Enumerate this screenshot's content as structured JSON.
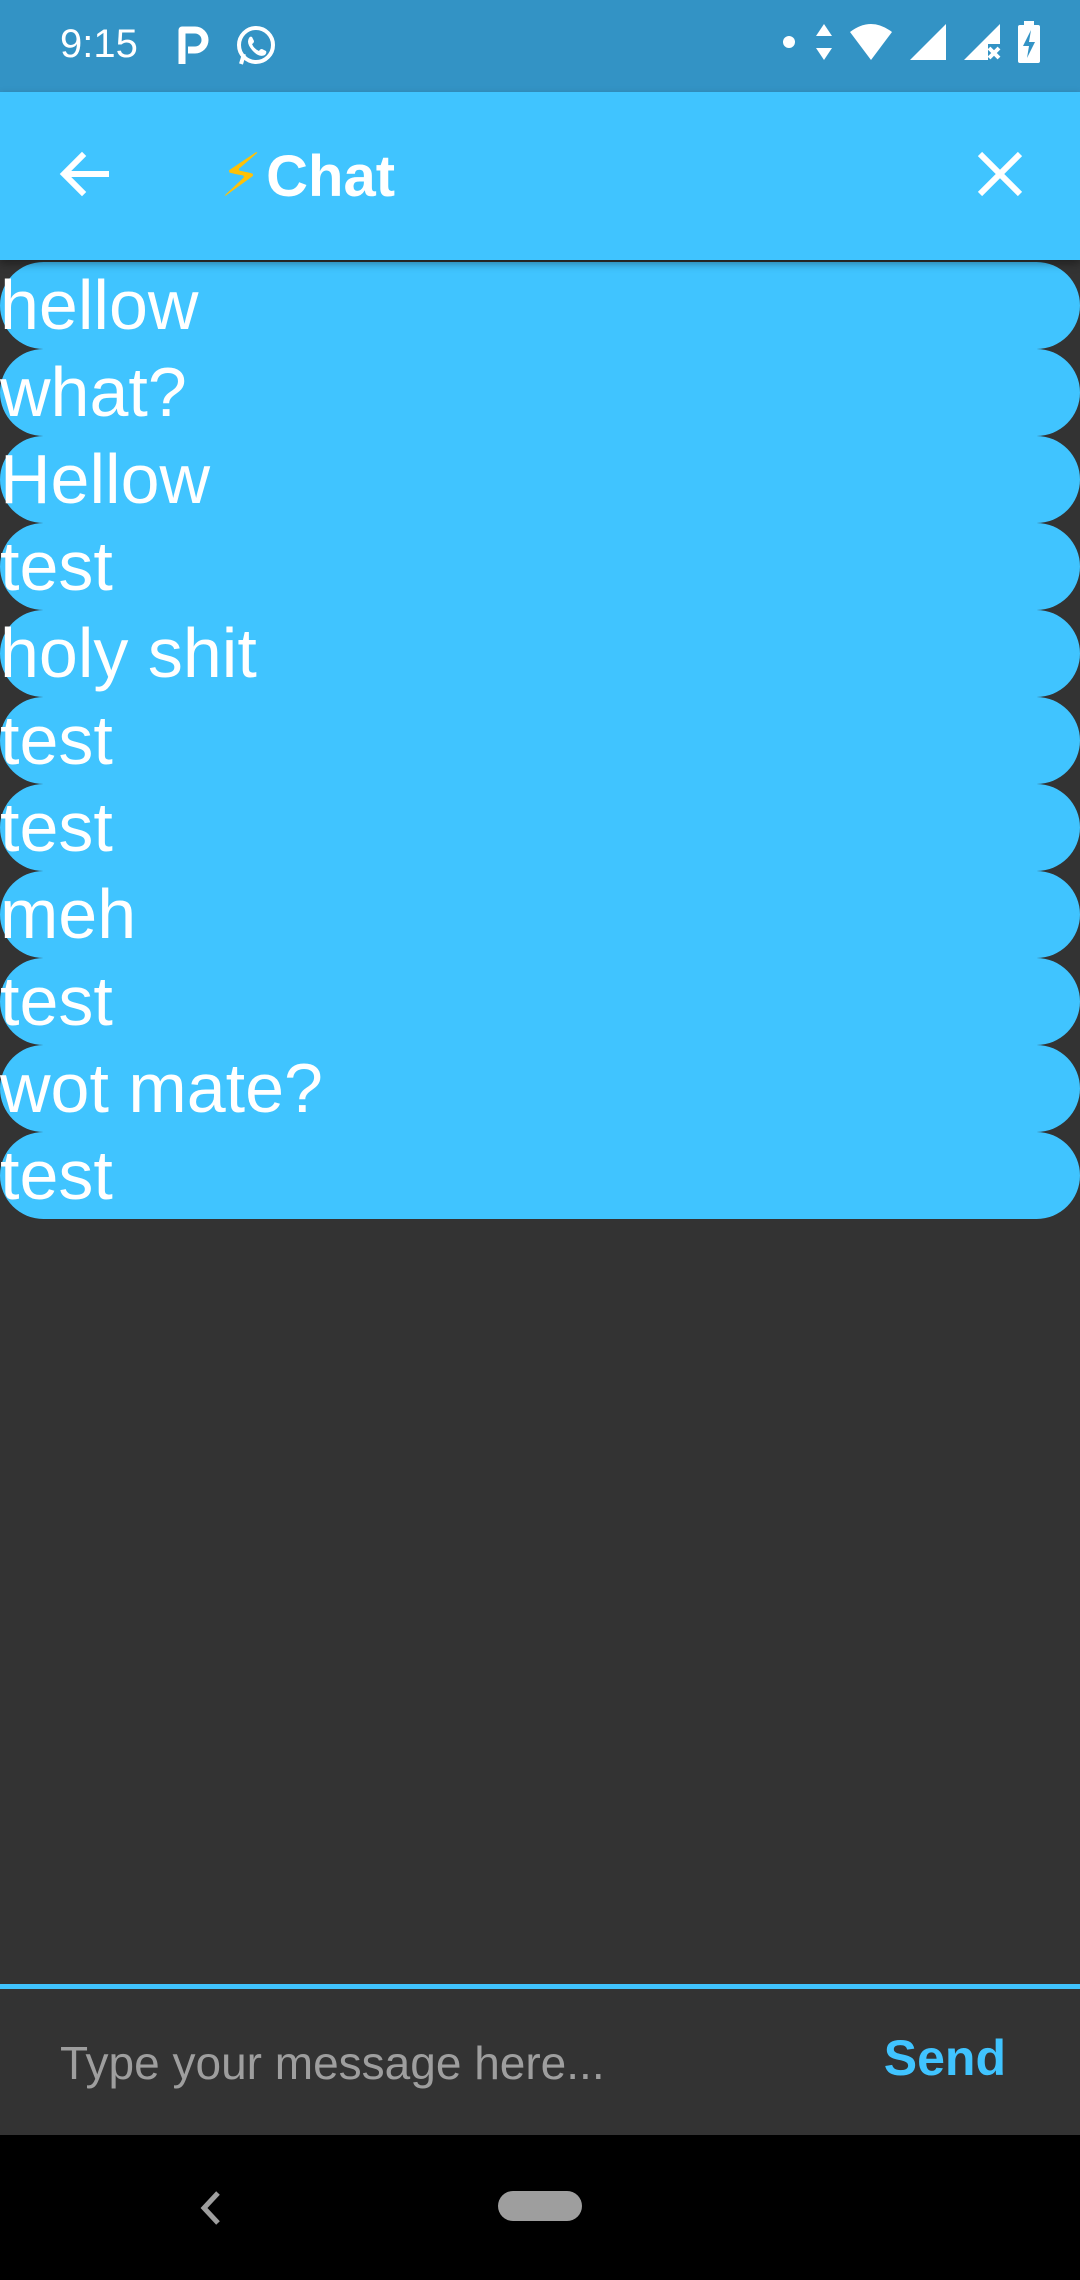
{
  "status_bar": {
    "time": "9:15",
    "left_icons": [
      "parking-icon",
      "whatsapp-icon"
    ],
    "right_icons": [
      "dot-icon",
      "data-arrows-icon",
      "wifi-icon",
      "signal-icon",
      "signal-no-sim-icon",
      "battery-charging-icon"
    ]
  },
  "app_bar": {
    "title_emoji": "⚡",
    "title": "Chat",
    "back_icon": "arrow-back-icon",
    "close_icon": "close-icon"
  },
  "messages": [
    "hellow",
    "what?",
    "Hellow",
    "test",
    "holy shit",
    "test",
    "test",
    "meh",
    "test",
    "wot mate?",
    "test"
  ],
  "composer": {
    "placeholder": "Type your message here...",
    "value": "",
    "send_label": "Send"
  },
  "colors": {
    "accent": "#40C4FF",
    "status_bar": "#3393C5",
    "background": "#333333",
    "bolt": "#FFC107"
  },
  "nav_bar": {
    "back_icon": "nav-back-icon",
    "home_icon": "nav-home-pill"
  }
}
